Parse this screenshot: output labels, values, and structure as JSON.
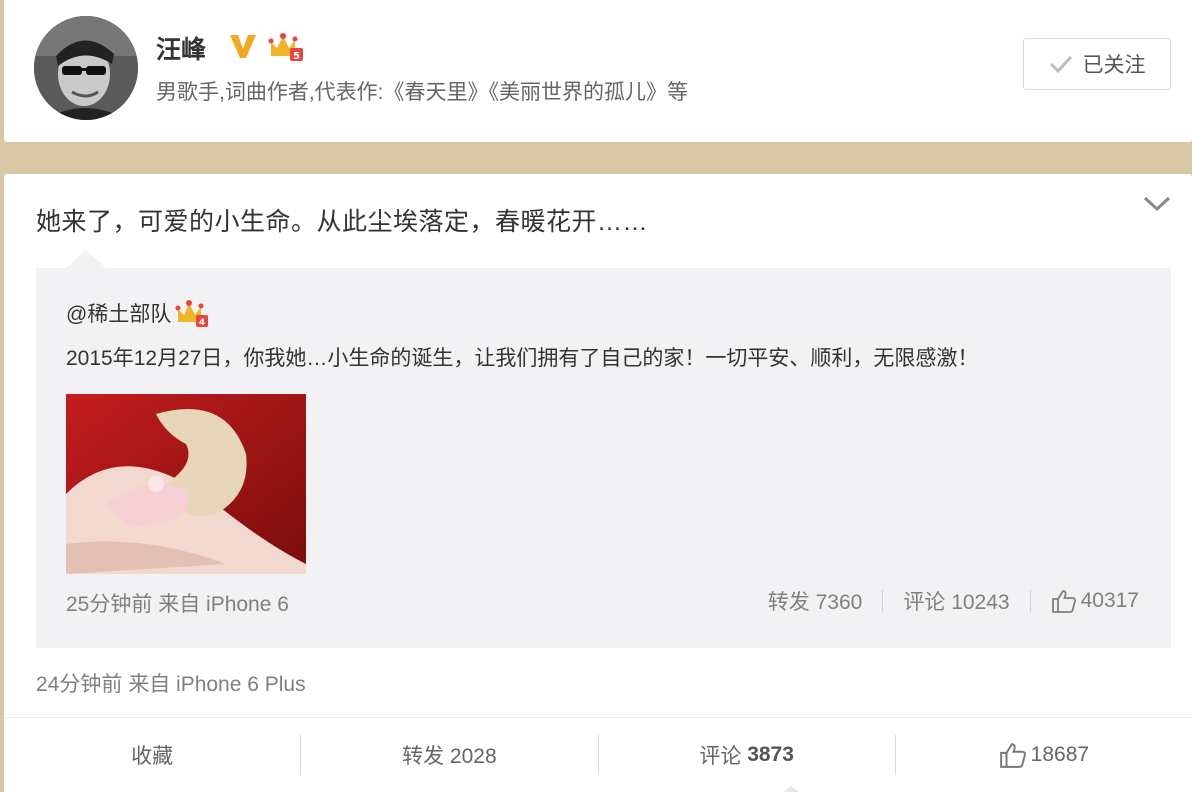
{
  "profile": {
    "name": "汪峰",
    "description": "男歌手,词曲作者,代表作:《春天里》《美丽世界的孤儿》等",
    "follow_label": "已关注",
    "icons": {
      "avatar": "avatar-photo",
      "verified": "verified-v-icon",
      "crown": "member-crown-icon",
      "check": "check-icon"
    }
  },
  "post": {
    "text": "她来了，可爱的小生命。从此尘埃落定，春暖花开……",
    "meta": "24分钟前 来自 iPhone 6 Plus",
    "repost": {
      "author": "@稀土部队",
      "text": "2015年12月27日，你我她…小生命的诞生，让我们拥有了自己的家！一切平安、顺利，无限感激！",
      "image": "baby-hand-photo",
      "meta": "25分钟前 来自 iPhone 6",
      "forward_label": "转发 7360",
      "comment_label": "评论 10243",
      "like_count": "40317"
    },
    "actions": {
      "favorite": "收藏",
      "forward": "转发 2028",
      "comment_prefix": "评论",
      "comment_count": "3873",
      "like_count": "18687"
    }
  },
  "colors": {
    "page_bg": "#d9c7a6",
    "card_bg": "#ffffff",
    "repost_bg": "#f2f2f5",
    "verified_gold": "#f5a623",
    "muted_text": "#808080"
  }
}
